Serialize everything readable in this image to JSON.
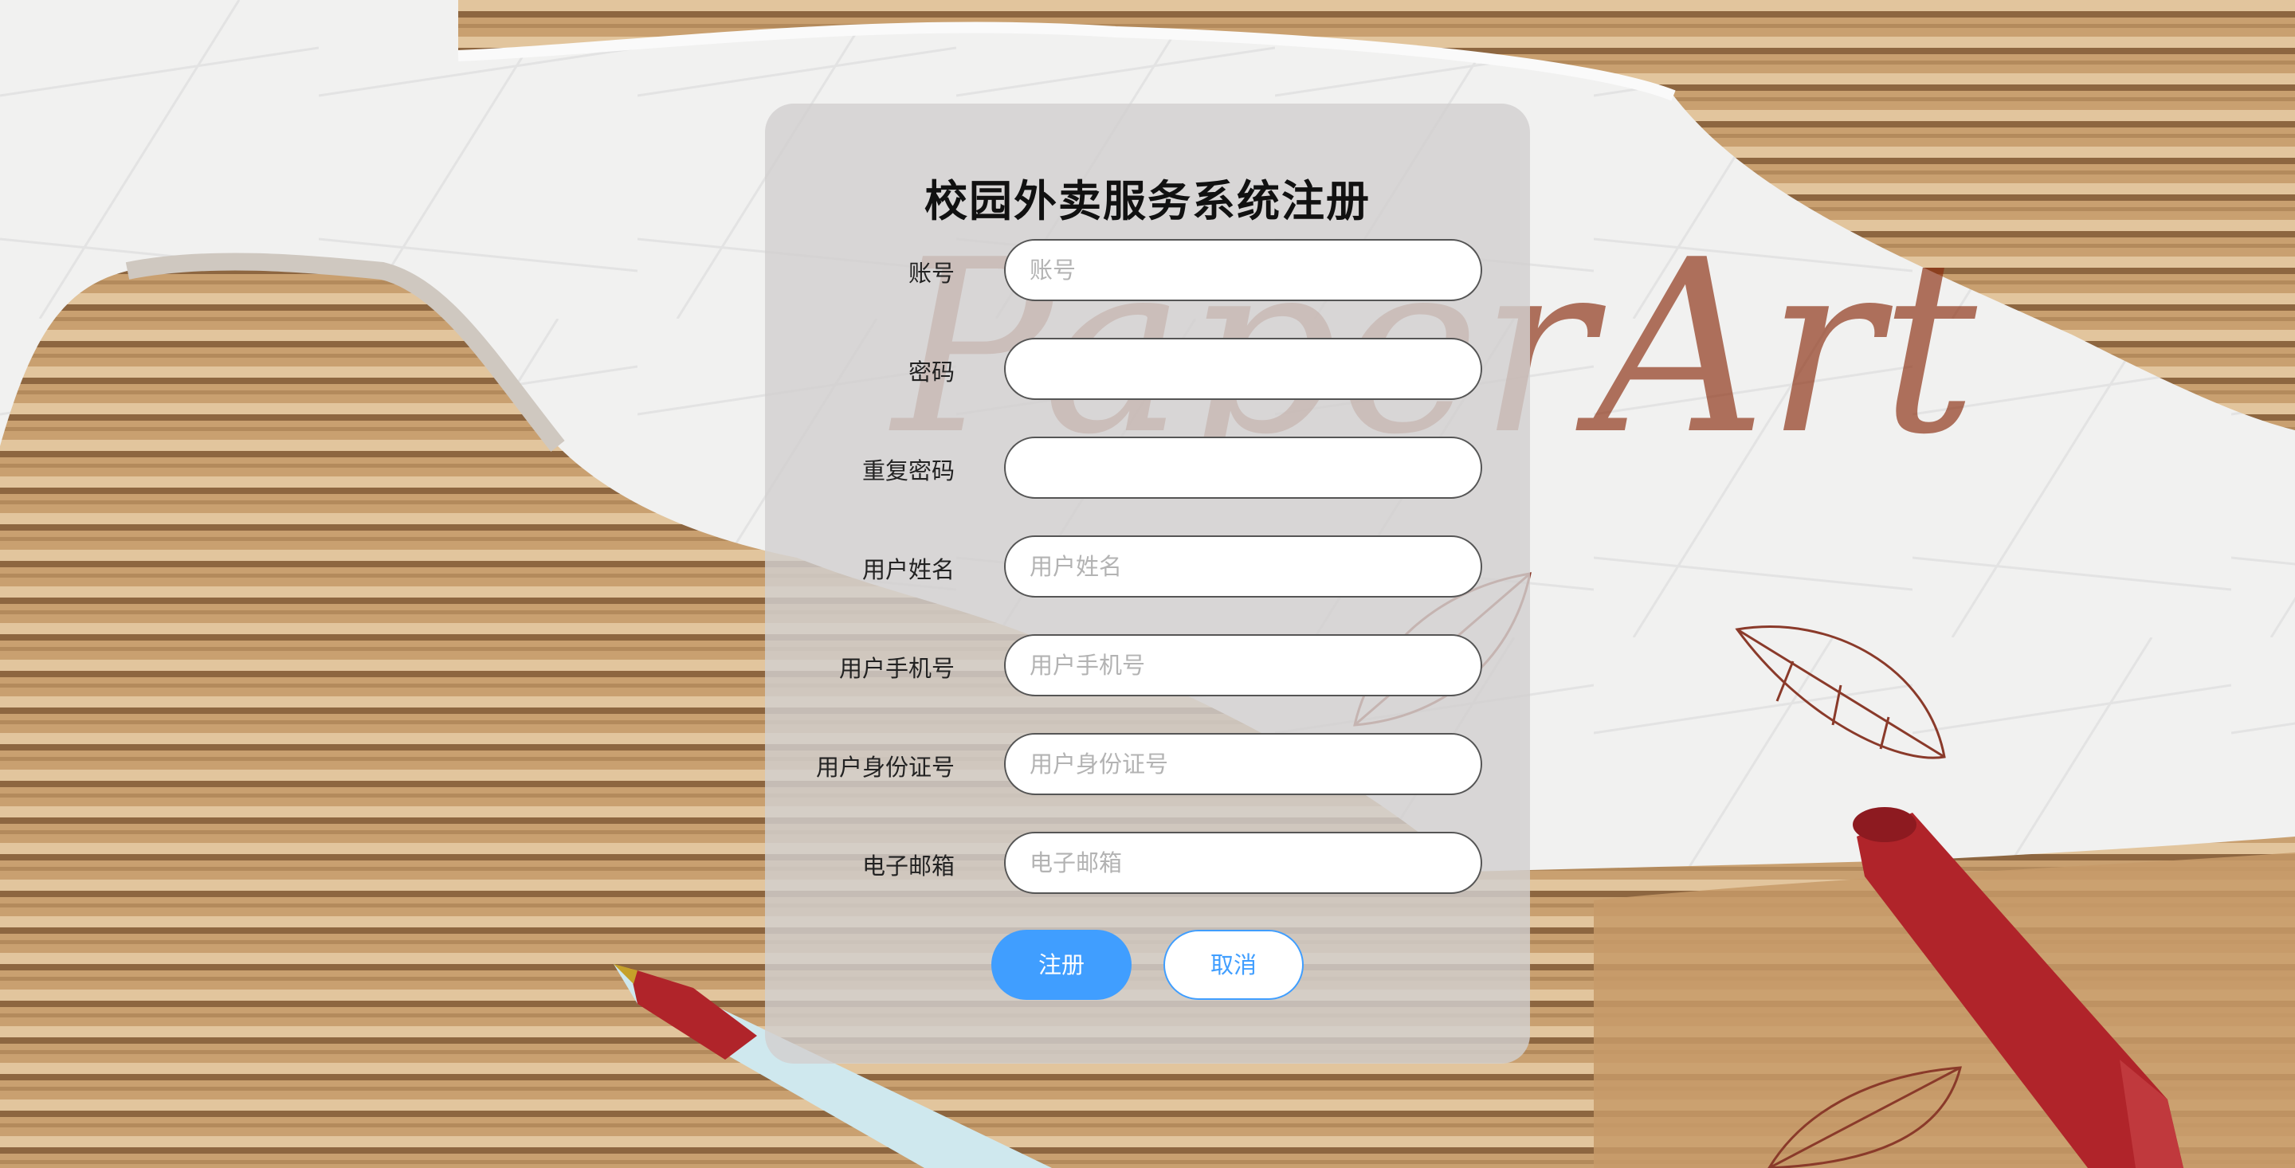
{
  "background": {
    "watermark_text": "PaperArt",
    "colors": {
      "paper": "#f3f3f2",
      "cardboard": "#c69c6d",
      "cardboard_dark": "#9b7248",
      "script": "#8a2b0c",
      "pen_red": "#b0242a",
      "pen_body": "#cfe8ee"
    }
  },
  "form": {
    "title": "校园外卖服务系统注册",
    "fields": [
      {
        "label": "账号",
        "placeholder": "账号",
        "value": ""
      },
      {
        "label": "密码",
        "placeholder": "",
        "value": ""
      },
      {
        "label": "重复密码",
        "placeholder": "",
        "value": ""
      },
      {
        "label": "用户姓名",
        "placeholder": "用户姓名",
        "value": ""
      },
      {
        "label": "用户手机号",
        "placeholder": "用户手机号",
        "value": ""
      },
      {
        "label": "用户身份证号",
        "placeholder": "用户身份证号",
        "value": ""
      },
      {
        "label": "电子邮箱",
        "placeholder": "电子邮箱",
        "value": ""
      }
    ],
    "buttons": {
      "register": "注册",
      "cancel": "取消"
    },
    "colors": {
      "accent": "#409eff",
      "card_bg": "rgba(210,208,208,0.82)"
    }
  }
}
